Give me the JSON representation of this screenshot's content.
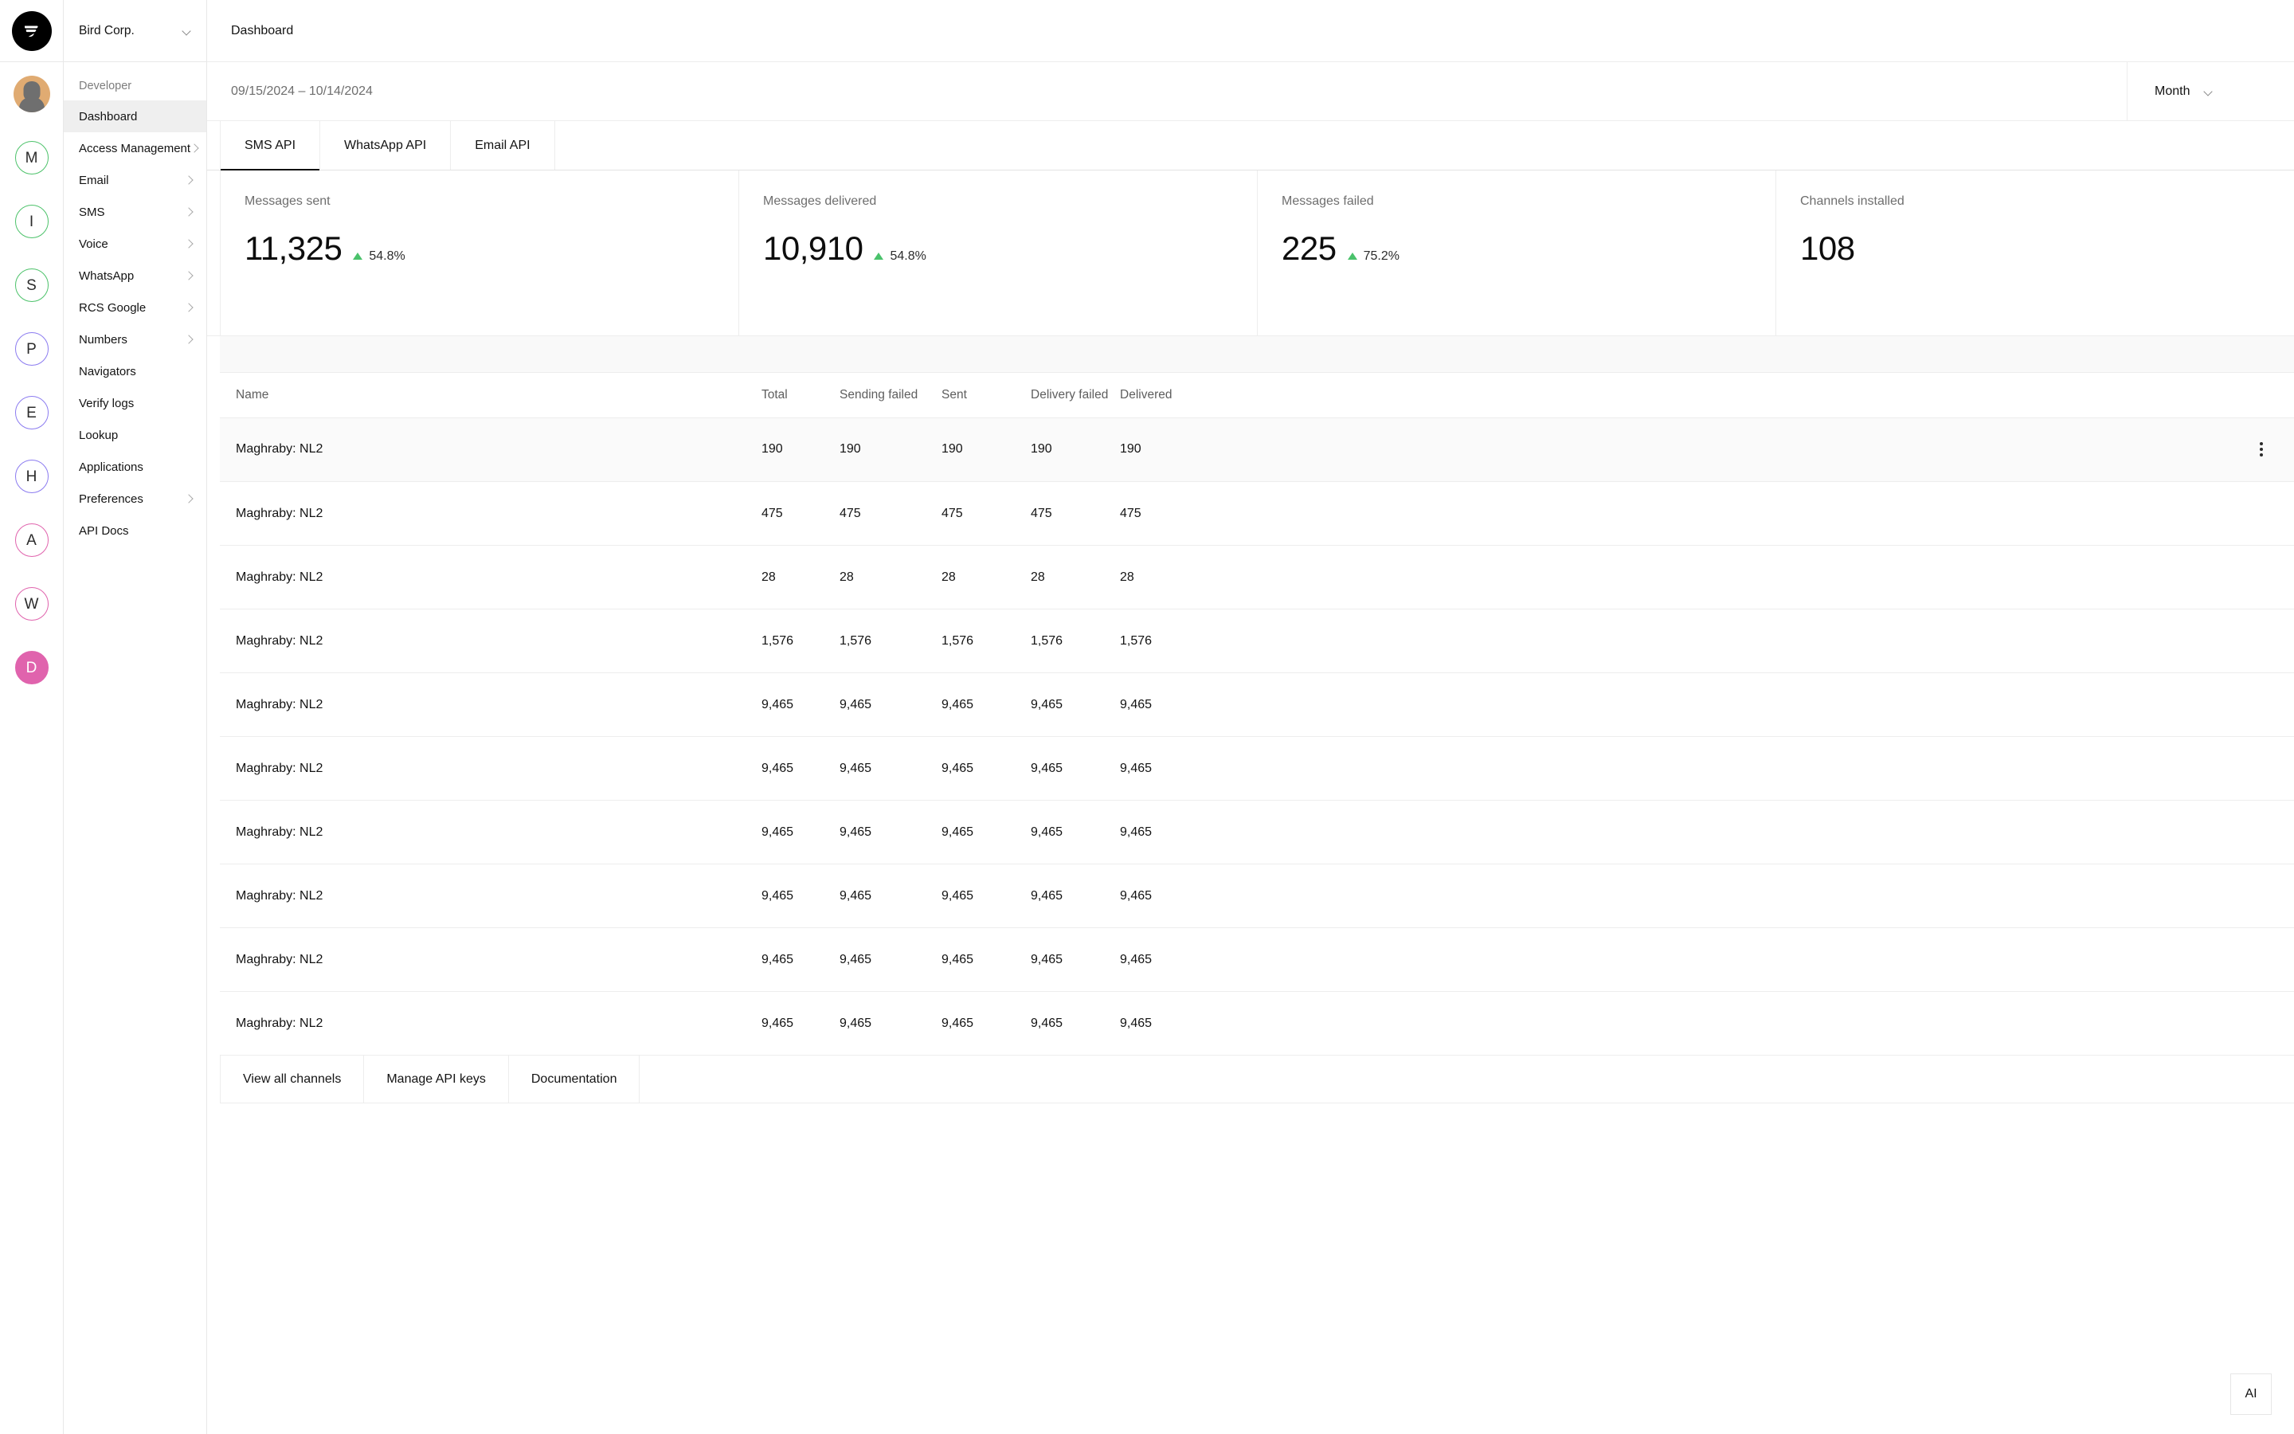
{
  "rail": {
    "logo_name": "bird-logo",
    "avatar_name": "user-avatar",
    "chips": [
      {
        "letter": "M",
        "color": "#4cc26a",
        "filled": false
      },
      {
        "letter": "I",
        "color": "#4cc26a",
        "filled": false
      },
      {
        "letter": "S",
        "color": "#4cc26a",
        "filled": false
      },
      {
        "letter": "P",
        "color": "#8b7bf0",
        "filled": false
      },
      {
        "letter": "E",
        "color": "#8b7bf0",
        "filled": false
      },
      {
        "letter": "H",
        "color": "#8b7bf0",
        "filled": false
      },
      {
        "letter": "A",
        "color": "#e063ad",
        "filled": false
      },
      {
        "letter": "W",
        "color": "#e063ad",
        "filled": false
      },
      {
        "letter": "D",
        "color": "#e063ad",
        "filled": true
      }
    ]
  },
  "sidebar": {
    "org_name": "Bird Corp.",
    "section_label": "Developer",
    "items": [
      {
        "label": "Dashboard",
        "expandable": false,
        "active": true
      },
      {
        "label": "Access Management",
        "expandable": true,
        "active": false
      },
      {
        "label": "Email",
        "expandable": true,
        "active": false
      },
      {
        "label": "SMS",
        "expandable": true,
        "active": false
      },
      {
        "label": "Voice",
        "expandable": true,
        "active": false
      },
      {
        "label": "WhatsApp",
        "expandable": true,
        "active": false
      },
      {
        "label": "RCS Google",
        "expandable": true,
        "active": false
      },
      {
        "label": "Numbers",
        "expandable": true,
        "active": false
      },
      {
        "label": "Navigators",
        "expandable": false,
        "active": false
      },
      {
        "label": "Verify logs",
        "expandable": false,
        "active": false
      },
      {
        "label": "Lookup",
        "expandable": false,
        "active": false
      },
      {
        "label": "Applications",
        "expandable": false,
        "active": false
      },
      {
        "label": "Preferences",
        "expandable": true,
        "active": false
      },
      {
        "label": "API Docs",
        "expandable": false,
        "active": false
      }
    ]
  },
  "header": {
    "title": "Dashboard",
    "date_range": "09/15/2024 – 10/14/2024",
    "period": "Month"
  },
  "tabs": [
    {
      "label": "SMS API",
      "active": true
    },
    {
      "label": "WhatsApp API",
      "active": false
    },
    {
      "label": "Email API",
      "active": false
    }
  ],
  "kpis": [
    {
      "label": "Messages sent",
      "value": "11,325",
      "delta": "54.8%",
      "trend": "up",
      "trend_color": "#4ac26b"
    },
    {
      "label": "Messages delivered",
      "value": "10,910",
      "delta": "54.8%",
      "trend": "up",
      "trend_color": "#4ac26b"
    },
    {
      "label": "Messages failed",
      "value": "225",
      "delta": "75.2%",
      "trend": "up",
      "trend_color": "#4ac26b"
    },
    {
      "label": "Channels installed",
      "value": "108",
      "delta": "",
      "trend": "",
      "trend_color": ""
    }
  ],
  "table": {
    "columns": [
      "Name",
      "Total",
      "Sending failed",
      "Sent",
      "Delivery failed",
      "Delivered"
    ],
    "rows": [
      {
        "name": "Maghraby: NL2",
        "total": "190",
        "sending_failed": "190",
        "sent": "190",
        "delivery_failed": "190",
        "delivered": "190",
        "has_menu": true
      },
      {
        "name": "Maghraby: NL2",
        "total": "475",
        "sending_failed": "475",
        "sent": "475",
        "delivery_failed": "475",
        "delivered": "475",
        "has_menu": false
      },
      {
        "name": "Maghraby: NL2",
        "total": "28",
        "sending_failed": "28",
        "sent": "28",
        "delivery_failed": "28",
        "delivered": "28",
        "has_menu": false
      },
      {
        "name": "Maghraby: NL2",
        "total": "1,576",
        "sending_failed": "1,576",
        "sent": "1,576",
        "delivery_failed": "1,576",
        "delivered": "1,576",
        "has_menu": false
      },
      {
        "name": "Maghraby: NL2",
        "total": "9,465",
        "sending_failed": "9,465",
        "sent": "9,465",
        "delivery_failed": "9,465",
        "delivered": "9,465",
        "has_menu": false
      },
      {
        "name": "Maghraby: NL2",
        "total": "9,465",
        "sending_failed": "9,465",
        "sent": "9,465",
        "delivery_failed": "9,465",
        "delivered": "9,465",
        "has_menu": false
      },
      {
        "name": "Maghraby: NL2",
        "total": "9,465",
        "sending_failed": "9,465",
        "sent": "9,465",
        "delivery_failed": "9,465",
        "delivered": "9,465",
        "has_menu": false
      },
      {
        "name": "Maghraby: NL2",
        "total": "9,465",
        "sending_failed": "9,465",
        "sent": "9,465",
        "delivery_failed": "9,465",
        "delivered": "9,465",
        "has_menu": false
      },
      {
        "name": "Maghraby: NL2",
        "total": "9,465",
        "sending_failed": "9,465",
        "sent": "9,465",
        "delivery_failed": "9,465",
        "delivered": "9,465",
        "has_menu": false
      },
      {
        "name": "Maghraby: NL2",
        "total": "9,465",
        "sending_failed": "9,465",
        "sent": "9,465",
        "delivery_failed": "9,465",
        "delivered": "9,465",
        "has_menu": false
      }
    ]
  },
  "actions": [
    {
      "label": "View all channels"
    },
    {
      "label": "Manage API keys"
    },
    {
      "label": "Documentation"
    }
  ],
  "ai_badge": {
    "label": "AI"
  }
}
